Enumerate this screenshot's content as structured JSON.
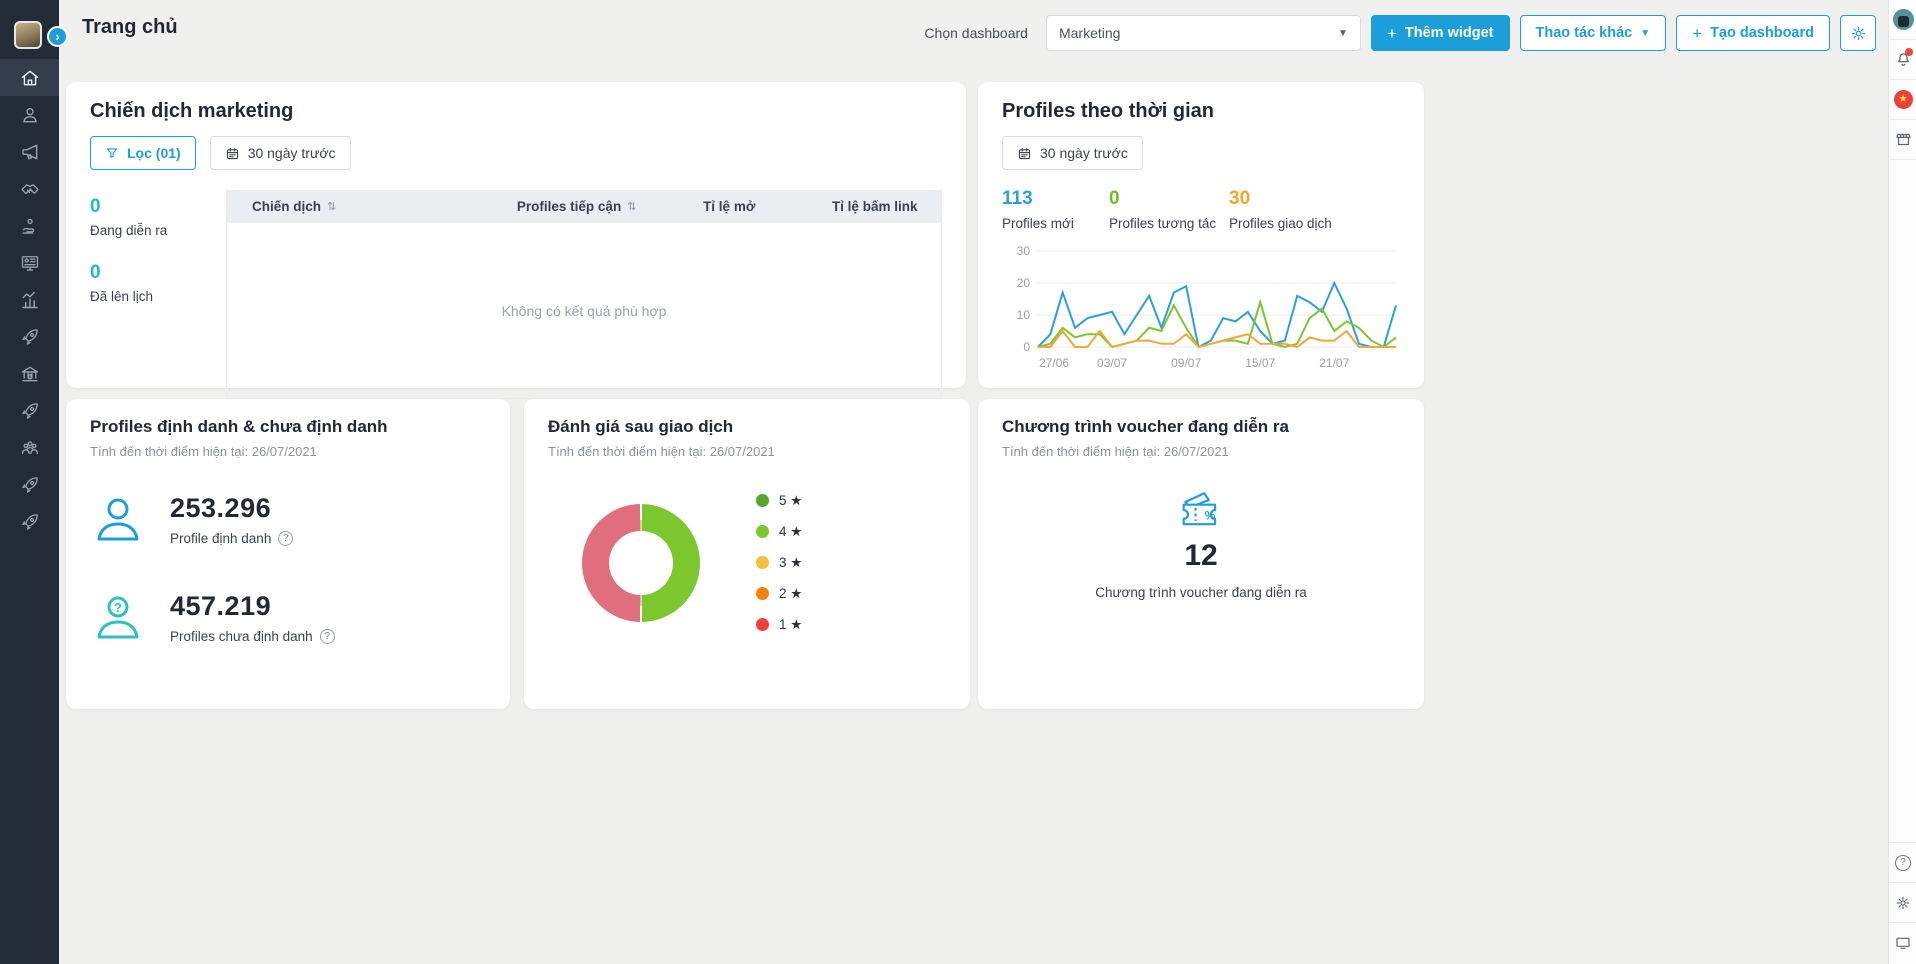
{
  "colors": {
    "accent": "#1a9ed9",
    "teal": "#26b8c5"
  },
  "header": {
    "title": "Trang chủ",
    "choose_dashboard_label": "Chọn dashboard",
    "dashboard_select_value": "Marketing",
    "add_widget_label": "Thêm widget",
    "more_actions_label": "Thao tác khác",
    "create_dashboard_label": "Tạo dashboard"
  },
  "sidebar": {
    "icons": [
      "home",
      "user",
      "megaphone",
      "handshake",
      "hand-user",
      "monitor",
      "chart",
      "rocket",
      "bank",
      "rocket",
      "users",
      "rocket",
      "rocket"
    ],
    "active_index": 0
  },
  "right_rail": {
    "top_icons": [
      "avatar",
      "bell-with-badge",
      "star-flag",
      "storefront"
    ],
    "bottom_icons": [
      "help",
      "settings",
      "display"
    ]
  },
  "cards": {
    "campaigns": {
      "title": "Chiến dịch marketing",
      "filter_label": "Lọc (01)",
      "date_range_label": "30 ngày trước",
      "stats": [
        {
          "value": "0",
          "label": "Đang diễn ra"
        },
        {
          "value": "0",
          "label": "Đã lên lịch"
        }
      ],
      "table": {
        "columns": [
          "Chiến dịch",
          "Profiles tiếp cận",
          "Tỉ lệ mở",
          "Tỉ lệ bấm link"
        ],
        "empty_text": "Không có kết quả phù hợp"
      }
    },
    "profiles_over_time": {
      "title": "Profiles theo thời gian",
      "date_range_label": "30 ngày trước",
      "stats": [
        {
          "value": "113",
          "label": "Profiles mới",
          "color": "#2b9fd9"
        },
        {
          "value": "0",
          "label": "Profiles tương tác",
          "color": "#6cc024"
        },
        {
          "value": "30",
          "label": "Profiles giao dịch",
          "color": "#f5a623"
        }
      ]
    },
    "identified": {
      "title": "Profiles định danh & chưa định danh",
      "as_of": "Tính đến thời điểm hiện tại: 26/07/2021",
      "rows": [
        {
          "value": "253.296",
          "label": "Profile định danh"
        },
        {
          "value": "457.219",
          "label": "Profiles chưa định danh"
        }
      ]
    },
    "ratings": {
      "title": "Đánh giá sau giao dịch",
      "as_of": "Tính đến thời điểm hiện tại: 26/07/2021",
      "legend": [
        {
          "label": "5 ★",
          "color": "#55a62a"
        },
        {
          "label": "4 ★",
          "color": "#7cc62e"
        },
        {
          "label": "3 ★",
          "color": "#f3c13a"
        },
        {
          "label": "2 ★",
          "color": "#f5820d"
        },
        {
          "label": "1 ★",
          "color": "#f4403a"
        }
      ]
    },
    "vouchers": {
      "title": "Chương trình voucher đang diễn ra",
      "as_of": "Tính đến thời điểm hiện tại: 26/07/2021",
      "value": "12",
      "label": "Chương trình voucher đang diễn ra"
    }
  },
  "chart_data": [
    {
      "type": "line",
      "title": "Profiles theo thời gian",
      "n_points": 30,
      "ylim": [
        0,
        30
      ],
      "y_ticks": [
        0,
        10,
        20,
        30
      ],
      "x_tick_labels": [
        "27/06",
        "03/07",
        "09/07",
        "15/07",
        "21/07"
      ],
      "x_tick_indices": [
        0,
        6,
        12,
        18,
        24
      ],
      "grid": true,
      "legend_position": "none",
      "series": [
        {
          "name": "Profiles mới",
          "color": "#2b9fd9",
          "values": [
            0,
            4,
            17,
            6,
            9,
            10,
            11,
            4,
            10,
            16,
            6,
            17,
            19,
            0,
            2,
            9,
            8,
            11,
            5,
            1,
            2,
            16,
            14,
            11,
            20,
            12,
            1,
            0,
            0,
            13
          ]
        },
        {
          "name": "Profiles tương tác",
          "color": "#7cc62e",
          "values": [
            0,
            1,
            6,
            3,
            4,
            4,
            0,
            1,
            2,
            6,
            5,
            13,
            6,
            0,
            1,
            2,
            2,
            1,
            14,
            1,
            0,
            1,
            9,
            12,
            5,
            8,
            6,
            2,
            0,
            3
          ]
        },
        {
          "name": "Profiles giao dịch",
          "color": "#f2a63b",
          "values": [
            0,
            0,
            5,
            0,
            0,
            5,
            0,
            1,
            2,
            2,
            1,
            1,
            4,
            0,
            1,
            2,
            3,
            4,
            1,
            1,
            1,
            0,
            3,
            2,
            2,
            5,
            0,
            0,
            0,
            0
          ]
        }
      ]
    },
    {
      "type": "pie",
      "title": "Đánh giá sau giao dịch",
      "donut": true,
      "segments": [
        {
          "color": "#7cc62e",
          "fraction": 0.5
        },
        {
          "color": "#e06e7c",
          "fraction": 0.5
        }
      ],
      "legend_position": "right"
    }
  ]
}
